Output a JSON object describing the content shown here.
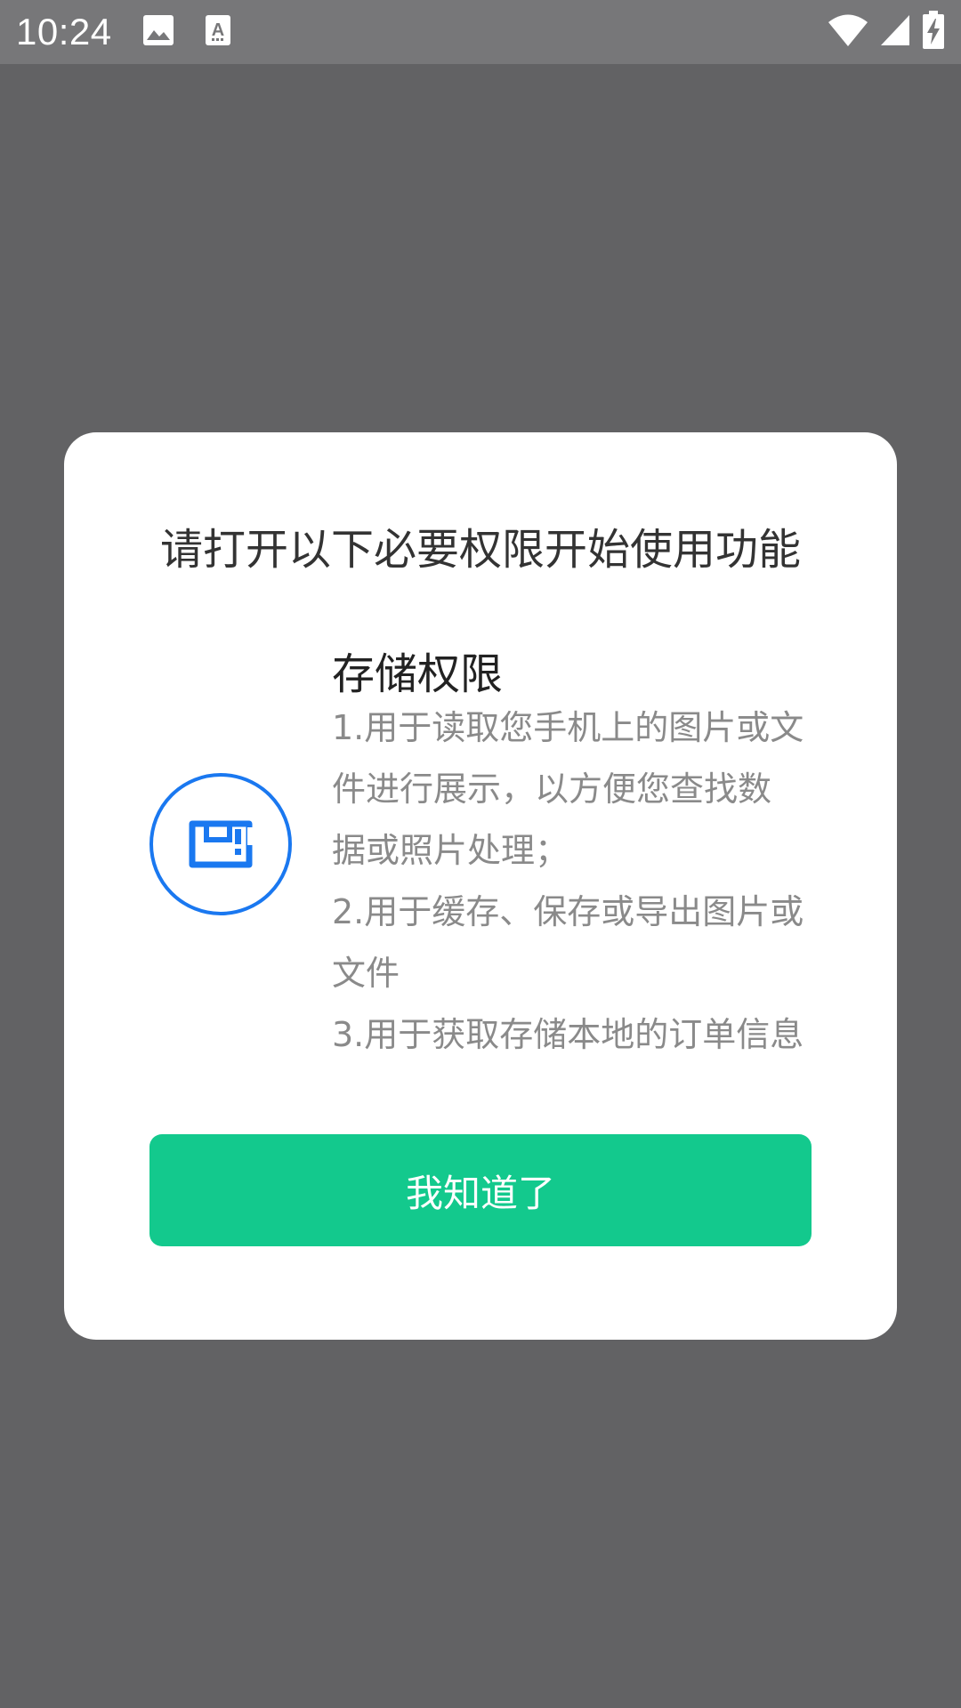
{
  "status_bar": {
    "time": "10:24",
    "left_icons": [
      "image-icon",
      "keyboard-a-icon"
    ],
    "right_icons": [
      "wifi-icon",
      "cell-signal-icon",
      "battery-charging-icon"
    ]
  },
  "dialog": {
    "title": "请打开以下必要权限开始使用功能",
    "permission": {
      "icon": "save-icon",
      "icon_color": "#1a78f0",
      "name": "存储权限",
      "desc_lines": [
        "1.用于读取您手机上的图片或文",
        "件进行展示，以方便您查找数",
        "据或照片处理；",
        "2.用于缓存、保存或导出图片或",
        "文件",
        "3.用于获取存储本地的订单信息"
      ]
    },
    "confirm_label": "我知道了",
    "confirm_color": "#13c98d"
  }
}
